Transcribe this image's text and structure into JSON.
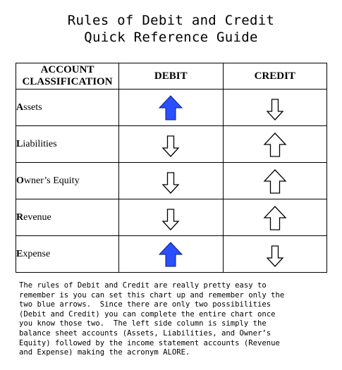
{
  "title": {
    "line1": "Rules of Debit and Credit",
    "line2": "Quick Reference Guide"
  },
  "table": {
    "headers": {
      "classification_line1": "ACCOUNT",
      "classification_line2": "CLASSIFICATION",
      "debit": "DEBIT",
      "credit": "CREDIT"
    },
    "rows": [
      {
        "initial": "A",
        "rest": "ssets",
        "debit": "up",
        "debit_style": "blue",
        "credit": "down",
        "credit_style": "outline"
      },
      {
        "initial": "L",
        "rest": "iabilities",
        "debit": "down",
        "debit_style": "outline",
        "credit": "up",
        "credit_style": "outline"
      },
      {
        "initial": "O",
        "rest": "wner’s Equity",
        "debit": "down",
        "debit_style": "outline",
        "credit": "up",
        "credit_style": "outline"
      },
      {
        "initial": "R",
        "rest": "evenue",
        "debit": "down",
        "debit_style": "outline",
        "credit": "up",
        "credit_style": "outline"
      },
      {
        "initial": "E",
        "rest": "xpense",
        "debit": "up",
        "debit_style": "blue",
        "credit": "down",
        "credit_style": "outline"
      }
    ]
  },
  "colors": {
    "blue_arrow_fill": "#2a4fff",
    "blue_arrow_edge": "#0a1a8a",
    "outline_arrow_stroke": "#000000"
  },
  "note": "The rules of Debit and Credit are really pretty easy to\nremember is you can set this chart up and remember only the\ntwo blue arrows.  Since there are only two possibilities\n(Debit and Credit) you can complete the entire chart once\nyou know those two.  The left side column is simply the\nbalance sheet accounts (Assets, Liabilities, and Owner’s\nEquity) followed by the income statement accounts (Revenue\nand Expense) making the acronym ALORE."
}
